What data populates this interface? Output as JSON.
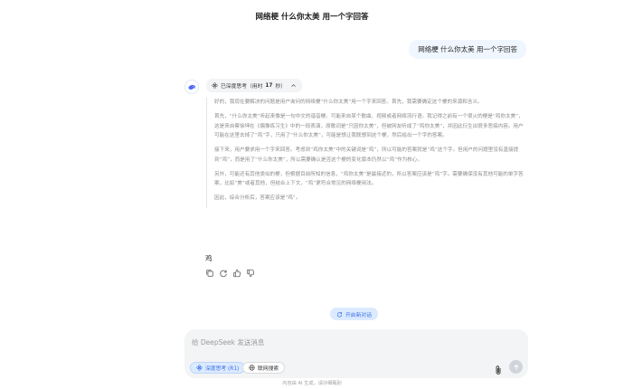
{
  "header": {
    "title": "网络梗 什么你太美 用一个字回答"
  },
  "conversation": {
    "user_message": "网络梗 什么你太美 用一个字回答",
    "thinking": {
      "toggle_label": "已深度思考（用时",
      "seconds": "17",
      "seconds_suffix": "秒）",
      "paragraphs": [
        "好的，我现在要解决的问题是用户询问的网络梗“什么你太美”用一个字来回答。首先，我需要确定这个梗的来源和含义。",
        "首先，“什么你太美”听起来像是一句中文的谐音梗。可能来自某个歌曲、视频或者网络流行语。我记得之前有一个很火的梗是“鸡你太美”，这是来自蔡徐坤在《偶像练习生》中的一段表演，原歌词是“只因你太美”，但被网友听成了“鸡你太美”，并因此衍生出很多恶搞内容。用户可能在这里去掉了“鸡”字，只用了“什么你太美”，可能是想让我联想到这个梗，然后给出一个字的答案。",
        "接下来，用户要求用一个字来回答。考虑到“鸡你太美”中的关键词是“鸡”，所以可能的答案就是“鸡”这个字。但用户的问题里没有直接提到“鸡”，而是用了“什么你太美”，所以需要确认是否这个梗的变化版本仍然以“鸡”作为核心。",
        "另外，可能还有其他类似的梗，但根据目前所知的信息，“鸡你太美”是最接近的，所以答案应该是“鸡”字。需要确保没有其他可能的单字答案，比如“美”或者其他，但结合上下文，“鸡”更符合常见的网络梗用法。",
        "因此，综合分析后，答案应该是“鸡”。"
      ]
    },
    "answer": "鸡",
    "actions": [
      "copy-icon",
      "regenerate-icon",
      "thumbs-up-icon",
      "thumbs-down-icon"
    ]
  },
  "new_chat": {
    "label": "开启新对话"
  },
  "composer": {
    "placeholder": "给 DeepSeek 发送消息",
    "deep_think_label": "深度思考 (R1)",
    "web_search_label": "联网搜索"
  },
  "footer": {
    "note": "内容由 AI 生成，请仔细甄别"
  },
  "colors": {
    "accent": "#3b6fe6",
    "accent_bg": "#dbeafe",
    "user_bubble": "#eff6ff"
  }
}
